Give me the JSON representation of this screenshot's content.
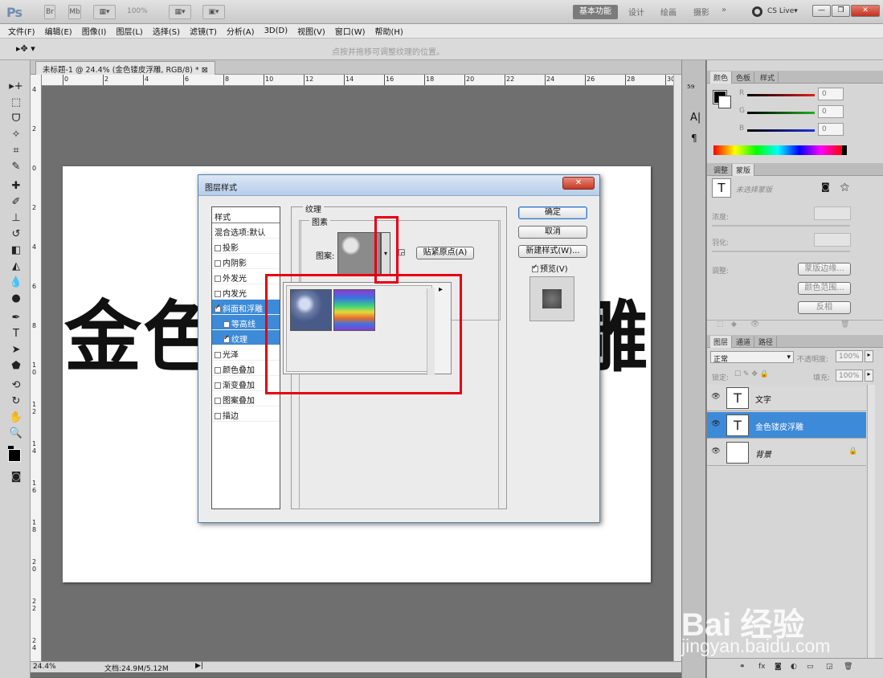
{
  "app": {
    "logo": "Ps",
    "zoom_display": "100%",
    "workspaces": [
      "基本功能",
      "设计",
      "绘画",
      "摄影",
      "»"
    ],
    "cs_live": "CS Live▾",
    "win_controls": [
      "—",
      "❐",
      "✕"
    ]
  },
  "menu": [
    "文件(F)",
    "编辑(E)",
    "图像(I)",
    "图层(L)",
    "选择(S)",
    "滤镜(T)",
    "分析(A)",
    "3D(D)",
    "视图(V)",
    "窗口(W)",
    "帮助(H)"
  ],
  "options_bar": {
    "hint": "点按并拖移可调整纹理的位置。"
  },
  "document": {
    "tab_title": "未标题-1 @ 24.4% (金色镂皮浮雕, RGB/8) *",
    "ruler_h": [
      "0",
      "2",
      "4",
      "6",
      "8",
      "10",
      "12",
      "14",
      "16",
      "18",
      "20",
      "22",
      "24",
      "26",
      "28",
      "30"
    ],
    "ruler_v": [
      "4",
      "2",
      "0",
      "2",
      "4",
      "6",
      "8",
      "1 0",
      "1 2",
      "1 4",
      "1 6",
      "1 8",
      "2 0",
      "2 2",
      "2 4"
    ],
    "canvas_text_left": "金色",
    "canvas_text_right": "雕",
    "status_zoom": "24.4%",
    "status_doc": "文档:24.9M/5.12M"
  },
  "dialog": {
    "title": "图层样式",
    "close_label": "✕",
    "styles_header": "样式",
    "blend_options": "混合选项:默认",
    "styles": [
      {
        "label": "投影",
        "checked": false,
        "selected": false,
        "sub": false
      },
      {
        "label": "内阴影",
        "checked": false,
        "selected": false,
        "sub": false
      },
      {
        "label": "外发光",
        "checked": false,
        "selected": false,
        "sub": false
      },
      {
        "label": "内发光",
        "checked": false,
        "selected": false,
        "sub": false
      },
      {
        "label": "斜面和浮雕",
        "checked": true,
        "selected": true,
        "sub": false
      },
      {
        "label": "等高线",
        "checked": false,
        "selected": true,
        "sub": true
      },
      {
        "label": "纹理",
        "checked": true,
        "selected": true,
        "sub": true
      },
      {
        "label": "光泽",
        "checked": false,
        "selected": false,
        "sub": false
      },
      {
        "label": "颜色叠加",
        "checked": false,
        "selected": false,
        "sub": false
      },
      {
        "label": "渐变叠加",
        "checked": false,
        "selected": false,
        "sub": false
      },
      {
        "label": "图案叠加",
        "checked": false,
        "selected": false,
        "sub": false
      },
      {
        "label": "描边",
        "checked": false,
        "selected": false,
        "sub": false
      }
    ],
    "section_title": "纹理",
    "subsection_title": "图素",
    "pattern_label": "图案:",
    "snap_button": "贴紧原点(A)",
    "ok": "确定",
    "cancel": "取消",
    "new_style": "新建样式(W)...",
    "preview": "预览(V)"
  },
  "panels": {
    "color_tabs": [
      "颜色",
      "色板",
      "样式"
    ],
    "channels": [
      {
        "label": "R",
        "value": "0",
        "color": "#e02020"
      },
      {
        "label": "G",
        "value": "0",
        "color": "#20b020"
      },
      {
        "label": "B",
        "value": "0",
        "color": "#2030e0"
      }
    ],
    "adjust_tabs": [
      "调整",
      "蒙版"
    ],
    "mask_title": "未选择蒙版",
    "density": "浓度:",
    "feather": "羽化:",
    "adjust_label": "调整:",
    "mask_edge": "蒙版边缘...",
    "color_range": "颜色范围...",
    "invert": "反相",
    "layers_tabs": [
      "图层",
      "通道",
      "路径"
    ],
    "blend_mode": "正常",
    "opacity_label": "不透明度:",
    "opacity": "100%",
    "lock_label": "锁定:",
    "fill_label": "填充:",
    "fill": "100%",
    "layers": [
      {
        "name": "文字",
        "selected": false,
        "thumb": "T"
      },
      {
        "name": "金色镂皮浮雕",
        "selected": true,
        "thumb": "T"
      },
      {
        "name": "背景",
        "selected": false,
        "thumb": ""
      }
    ]
  },
  "watermark": {
    "brand": "Bai 经验",
    "url": "jingyan.baidu.com"
  }
}
